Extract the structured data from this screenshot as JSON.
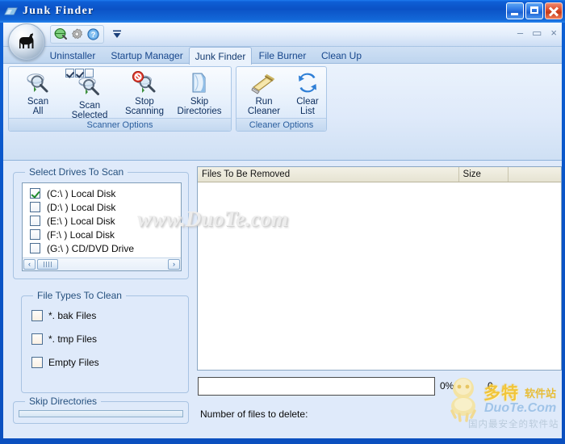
{
  "window": {
    "title": "Junk Finder",
    "icon": "app-window-icon",
    "controls": {
      "minimize": "minimize-button",
      "maximize": "maximize-button",
      "close": "close-button"
    }
  },
  "quick_access": {
    "items": [
      {
        "name": "globe-icon",
        "tooltip": "Web"
      },
      {
        "name": "gear-icon",
        "tooltip": "Settings"
      },
      {
        "name": "help-icon",
        "tooltip": "Help"
      }
    ],
    "dropdown": "customize-dropdown-arrow"
  },
  "mdi_controls": {
    "minimize": "–",
    "restore": "▭",
    "close": "×"
  },
  "tabs": [
    {
      "label": "Uninstaller",
      "active": false
    },
    {
      "label": "Startup Manager",
      "active": false
    },
    {
      "label": "Junk Finder",
      "active": true
    },
    {
      "label": "File Burner",
      "active": false
    },
    {
      "label": "Clean Up",
      "active": false
    }
  ],
  "ribbon": {
    "groups": [
      {
        "label": "Scanner Options",
        "buttons": [
          {
            "label": "Scan\nAll",
            "icon": "scan-all-icon",
            "badge": null
          },
          {
            "label": "Scan\nSelected",
            "icon": "scan-selected-icon",
            "badge": [
              true,
              true,
              false
            ]
          },
          {
            "label": "Stop\nScanning",
            "icon": "stop-scanning-icon",
            "badge": null
          },
          {
            "label": "Skip\nDirectories",
            "icon": "skip-directories-icon",
            "badge": null
          }
        ]
      },
      {
        "label": "Cleaner Options",
        "buttons": [
          {
            "label": "Run\nCleaner",
            "icon": "run-cleaner-icon",
            "badge": null
          },
          {
            "label": "Clear\nList",
            "icon": "clear-list-icon",
            "badge": null
          }
        ]
      }
    ]
  },
  "drives_panel": {
    "title": "Select Drives To Scan",
    "items": [
      {
        "label": "(C:\\ ) Local Disk",
        "checked": true
      },
      {
        "label": "(D:\\ ) Local Disk",
        "checked": false
      },
      {
        "label": "(E:\\ ) Local Disk",
        "checked": false
      },
      {
        "label": "(F:\\ ) Local Disk",
        "checked": false
      },
      {
        "label": "(G:\\ ) CD/DVD Drive",
        "checked": false
      }
    ],
    "scrollbar": {
      "left_arrow": "‹",
      "right_arrow": "›"
    }
  },
  "filetypes_panel": {
    "title": "File Types To Clean",
    "items": [
      {
        "label": "*. bak Files",
        "checked": false
      },
      {
        "label": "*. tmp Files",
        "checked": false
      },
      {
        "label": "Empty Files",
        "checked": false
      }
    ]
  },
  "skipdirs_panel": {
    "title": "Skip Directories",
    "items": []
  },
  "file_list": {
    "columns": [
      "Files To Be Removed",
      "Size",
      ""
    ],
    "rows": []
  },
  "status": {
    "progress_percent": "0%",
    "count": "0",
    "files_to_delete_label": "Number of files to delete:",
    "files_to_delete_value": ""
  },
  "watermarks": {
    "center": "www.DuoTe.com",
    "logo_cn": "多特",
    "logo_cn2": "软件站",
    "logo_en": "DuoTe.Com",
    "logo_sub": "国内最安全的软件站"
  }
}
